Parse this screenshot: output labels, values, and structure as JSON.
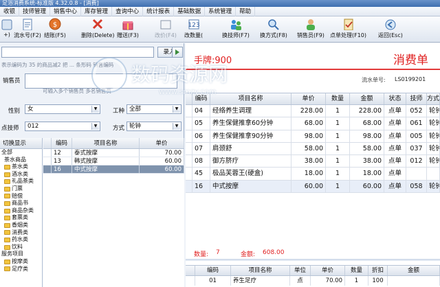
{
  "window": {
    "title": "足浴消费系统-标准版 4.32.0.8 - [消费]"
  },
  "menu": [
    "收银",
    "技师管理",
    "销售中心",
    "库存管理",
    "查询中心",
    "统计报表",
    "基础数据",
    "系统管理",
    "帮助"
  ],
  "toolbar": [
    {
      "label": "+)",
      "icon": "add-icon"
    },
    {
      "label": "流水号(F2)",
      "icon": "serial-icon"
    },
    {
      "label": "结账(F5)",
      "icon": "checkout-coin-icon"
    },
    {
      "label": "删除(Delete)",
      "icon": "delete-x-icon"
    },
    {
      "label": "赠送(F3)",
      "icon": "gift-icon"
    },
    {
      "label": "改价(F4)",
      "icon": "price-icon"
    },
    {
      "label": "改数量(",
      "icon": "quantity-icon"
    },
    {
      "label": "换技师(F7)",
      "icon": "change-tech-icon"
    },
    {
      "label": "换方式(F8)",
      "icon": "change-mode-icon"
    },
    {
      "label": "销售员(F9)",
      "icon": "salesman-icon"
    },
    {
      "label": "点单处理(F10)",
      "icon": "order-process-icon"
    },
    {
      "label": "返回(Esc)",
      "icon": "back-icon"
    }
  ],
  "left": {
    "enter_button": "录入",
    "hint": "表示编码为 35 的商品减2 把 ... 条形码  销售编码",
    "salesman_label": "销售员",
    "salesman_hint": "可输入多个销售员  多名销售员",
    "gender_label": "性别",
    "gender_value": "女",
    "worktype_label": "工种",
    "worktype_value": "全部",
    "tech_label": "点技师",
    "tech_value": "012",
    "mode_label": "方式",
    "mode_value": "轮钟",
    "category_header": "切换显示",
    "categories": [
      {
        "label": "全部",
        "folder": false,
        "indent": 0
      },
      {
        "label": "茶水商品",
        "folder": false,
        "indent": 1
      },
      {
        "label": "茶水类",
        "folder": true,
        "indent": 1
      },
      {
        "label": "酒水类",
        "folder": true,
        "indent": 1
      },
      {
        "label": "礼品茶类",
        "folder": true,
        "indent": 1
      },
      {
        "label": "门票",
        "folder": true,
        "indent": 1
      },
      {
        "label": "赔偿",
        "folder": true,
        "indent": 1
      },
      {
        "label": "商品书",
        "folder": true,
        "indent": 1
      },
      {
        "label": "商品杂类",
        "folder": true,
        "indent": 1
      },
      {
        "label": "套票类",
        "folder": true,
        "indent": 1
      },
      {
        "label": "香烟类",
        "folder": true,
        "indent": 1
      },
      {
        "label": "消费类",
        "folder": true,
        "indent": 1
      },
      {
        "label": "药水类",
        "folder": true,
        "indent": 1
      },
      {
        "label": "饮料",
        "folder": true,
        "indent": 1
      },
      {
        "label": "服务项目",
        "folder": false,
        "indent": 0
      },
      {
        "label": "按摩类",
        "folder": true,
        "indent": 1
      },
      {
        "label": "足疗类",
        "folder": true,
        "indent": 1
      }
    ],
    "item_columns": [
      "编码",
      "项目名称",
      "单价"
    ],
    "items": [
      {
        "code": "12",
        "name": "泰式按摩",
        "price": "70.00",
        "selected": false
      },
      {
        "code": "13",
        "name": "韩式按摩",
        "price": "60.00",
        "selected": false
      },
      {
        "code": "16",
        "name": "中式按摩",
        "price": "60.00",
        "selected": true
      }
    ]
  },
  "right": {
    "hand_label": "手牌:900",
    "title": "消费单",
    "serial_label": "流水单号:",
    "serial_value": "LS0199201",
    "order_columns": [
      "编码",
      "项目名称",
      "单价",
      "数量",
      "金额",
      "状态",
      "技师",
      "方式"
    ],
    "orders": [
      {
        "code": "04",
        "name": "经络养生调理",
        "price": "228.00",
        "qty": "1",
        "amount": "228.00",
        "state": "点单",
        "tech": "052",
        "mode": "轮钟",
        "selected": false
      },
      {
        "code": "05",
        "name": "养生保健推拿60分钟",
        "price": "68.00",
        "qty": "1",
        "amount": "68.00",
        "state": "点单",
        "tech": "061",
        "mode": "轮钟",
        "selected": false
      },
      {
        "code": "06",
        "name": "养生保健推拿90分钟",
        "price": "98.00",
        "qty": "1",
        "amount": "98.00",
        "state": "点单",
        "tech": "005",
        "mode": "轮钟",
        "selected": false
      },
      {
        "code": "07",
        "name": "肩颈舒",
        "price": "58.00",
        "qty": "1",
        "amount": "58.00",
        "state": "点单",
        "tech": "037",
        "mode": "轮钟",
        "selected": false
      },
      {
        "code": "08",
        "name": "御方脐疗",
        "price": "38.00",
        "qty": "1",
        "amount": "38.00",
        "state": "点单",
        "tech": "012",
        "mode": "轮钟",
        "selected": false
      },
      {
        "code": "45",
        "name": "极品芙蓉王(硬盒)",
        "price": "18.00",
        "qty": "1",
        "amount": "18.00",
        "state": "点单",
        "tech": "",
        "mode": "",
        "selected": false
      },
      {
        "code": "16",
        "name": "中式按摩",
        "price": "60.00",
        "qty": "1",
        "amount": "60.00",
        "state": "点单",
        "tech": "058",
        "mode": "轮钟",
        "selected": true
      }
    ],
    "total_qty_label": "数量:",
    "total_qty": "7",
    "total_amount_label": "金额:",
    "total_amount": "608.00",
    "detail_columns": [
      "编码",
      "项目名称",
      "单位",
      "单价",
      "数量",
      "折扣",
      "金额"
    ],
    "details": [
      {
        "code": "01",
        "name": "养生足疗",
        "unit": "点",
        "price": "70.00",
        "qty": "1",
        "disc": "100",
        "amount": ""
      }
    ]
  },
  "watermark": {
    "text": "数码资源网",
    "url": "www.smzy.com"
  }
}
